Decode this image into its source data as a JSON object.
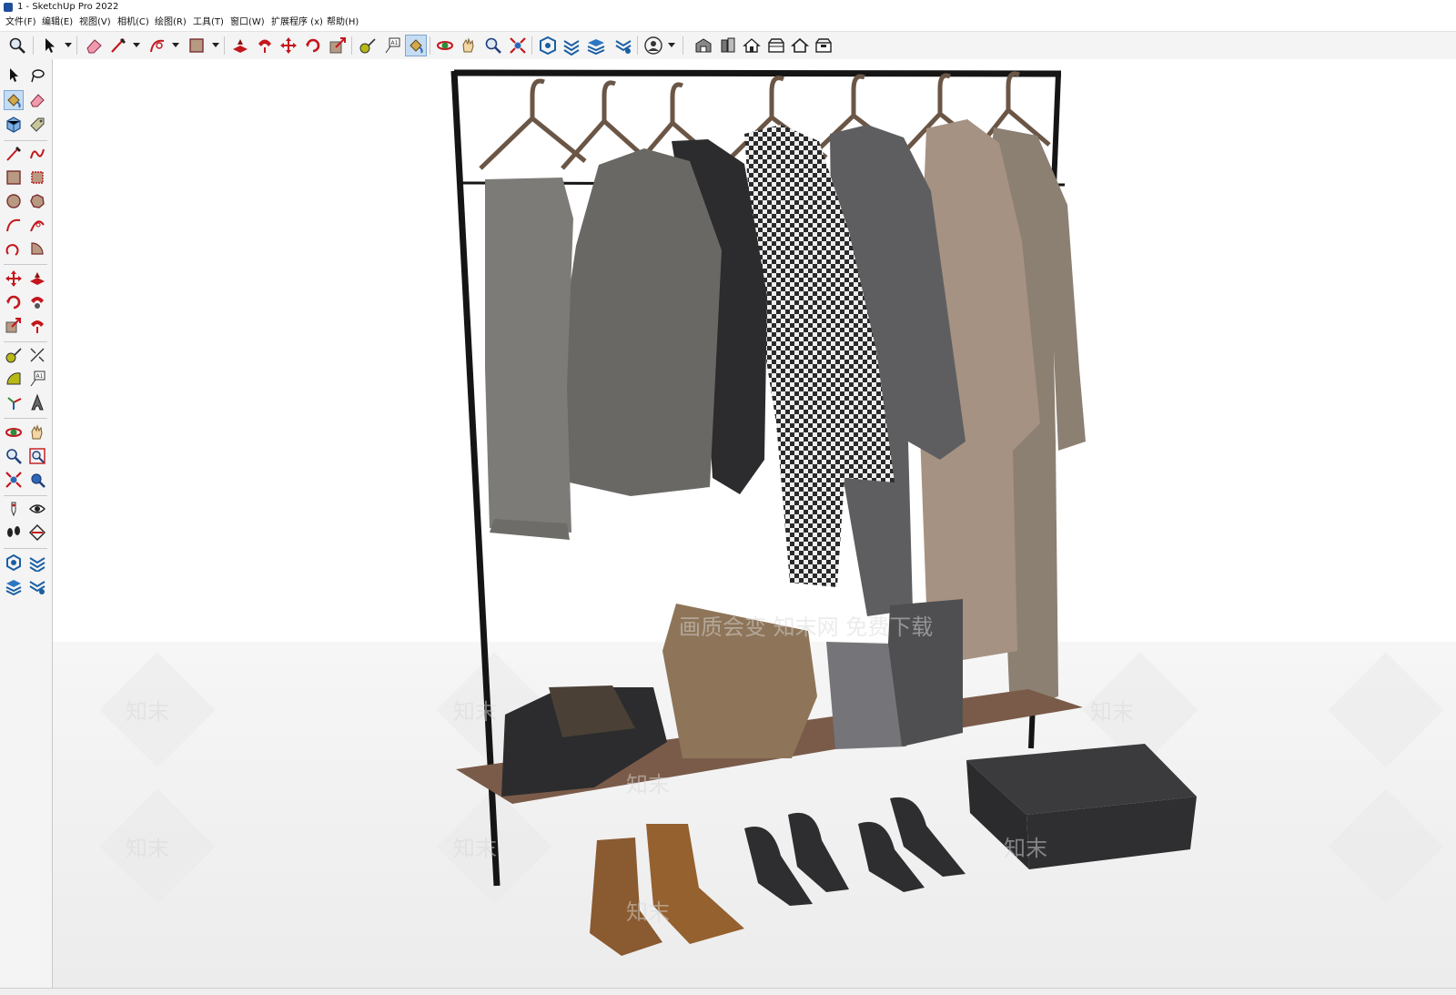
{
  "window": {
    "title": "1 - SketchUp Pro 2022"
  },
  "menu": [
    {
      "label": "文件(F)"
    },
    {
      "label": "编辑(E)"
    },
    {
      "label": "视图(V)"
    },
    {
      "label": "相机(C)"
    },
    {
      "label": "绘图(R)"
    },
    {
      "label": "工具(T)"
    },
    {
      "label": "窗口(W)"
    },
    {
      "label": "扩展程序 (x)"
    },
    {
      "label": "帮助(H)"
    }
  ],
  "toolbar": {
    "tools": [
      "zoom-icon",
      "select-icon",
      "eraser-icon",
      "pencil-line-icon",
      "arc-icon",
      "rectangle-icon",
      "push-pull-icon",
      "follow-me-icon",
      "move-icon",
      "rotate-icon",
      "scale-icon",
      "tape-measure-icon",
      "text-icon",
      "paint-bucket-icon",
      "orbit-icon",
      "pan-icon",
      "zoom-window-icon",
      "zoom-extents-icon",
      "section-plane-icon",
      "warehouse-icon",
      "layers-icon",
      "extension-icon",
      "account-icon",
      "components-icon",
      "materials-icon",
      "home-icon",
      "styles-icon",
      "house-outline-icon",
      "scenes-icon"
    ],
    "active_tool": "paint-bucket-icon"
  },
  "canvas": {
    "watermark_brand": "知末",
    "watermark_banner": "画质会变 知末网 免费下载"
  },
  "colors": {
    "accent": "#1e4e9c",
    "active_tool_bg": "#c6dcf2",
    "rack_metal": "#151515",
    "shelf_wood": "#7a5b49",
    "floor": "#efefef"
  }
}
